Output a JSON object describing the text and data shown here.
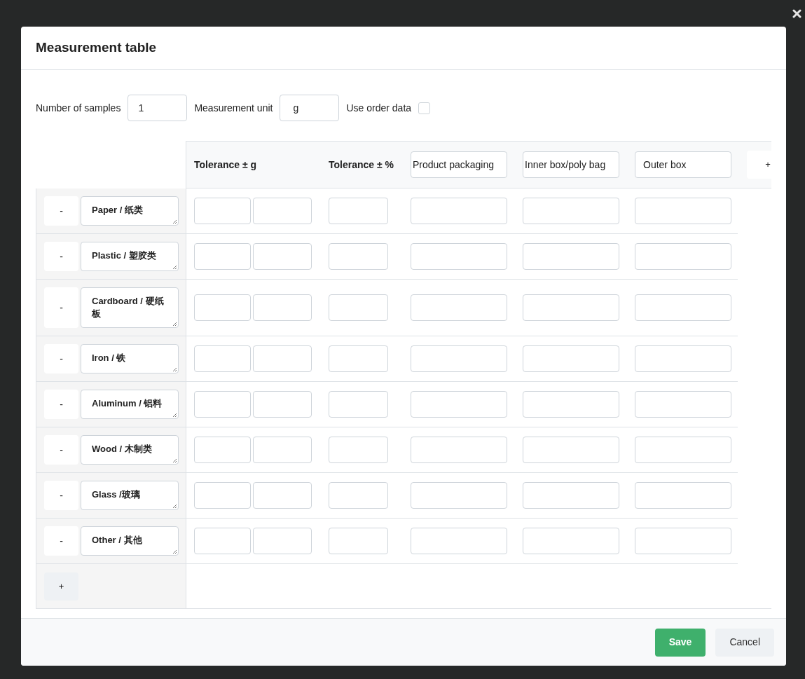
{
  "modal": {
    "title": "Measurement table"
  },
  "settings": {
    "samples": {
      "label": "Number of samples",
      "value": "1"
    },
    "unit": {
      "label": "Measurement unit",
      "value": "g"
    },
    "order_data": {
      "label": "Use order data",
      "checked": false
    }
  },
  "table": {
    "columns": [
      {
        "kind": "double",
        "label": "Tolerance ± g"
      },
      {
        "kind": "single",
        "label": "Tolerance ± %"
      },
      {
        "kind": "editable",
        "value": "Product packaging"
      },
      {
        "kind": "editable",
        "value": "Inner box/poly bag"
      },
      {
        "kind": "editable",
        "value": "Outer box"
      }
    ],
    "add_column": "+",
    "rows": [
      {
        "remove": "-",
        "name": "Paper / 纸类"
      },
      {
        "remove": "-",
        "name": "Plastic / 塑胶类"
      },
      {
        "remove": "-",
        "name": "Cardboard / 硬纸板"
      },
      {
        "remove": "-",
        "name": "Iron /  铁"
      },
      {
        "remove": "-",
        "name": "Aluminum / 铝料"
      },
      {
        "remove": "-",
        "name": "Wood / 木制类"
      },
      {
        "remove": "-",
        "name": "Glass /玻璃"
      },
      {
        "remove": "-",
        "name": "Other / 其他"
      }
    ],
    "add_row": "+"
  },
  "footer": {
    "buttons": [
      {
        "kind": "primary",
        "label": "Save"
      },
      {
        "kind": "secondary",
        "label": "Cancel"
      }
    ]
  }
}
